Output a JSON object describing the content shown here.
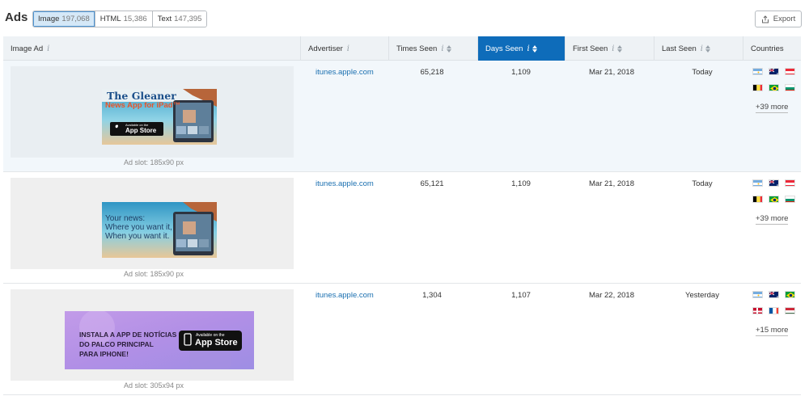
{
  "page": {
    "title": "Ads"
  },
  "filters": [
    {
      "label": "Image",
      "count": "197,068",
      "active": true
    },
    {
      "label": "HTML",
      "count": "15,386",
      "active": false
    },
    {
      "label": "Text",
      "count": "147,395",
      "active": false
    }
  ],
  "export_label": "Export",
  "columns": {
    "image_ad": "Image Ad",
    "advertiser": "Advertiser",
    "times_seen": "Times Seen",
    "days_seen": "Days Seen",
    "first_seen": "First Seen",
    "last_seen": "Last Seen",
    "countries": "Countries"
  },
  "rows": [
    {
      "advertiser": "itunes.apple.com",
      "times_seen": "65,218",
      "days_seen": "1,109",
      "first_seen": "Mar 21, 2018",
      "last_seen": "Today",
      "flags": [
        "argentina",
        "australia",
        "austria",
        "belgium",
        "brazil",
        "bulgaria"
      ],
      "more": "+39 more",
      "slot": "Ad slot: 185x90 px",
      "banner": {
        "line1": "The Gleaner",
        "line2": "News App for iPad™",
        "badge_small": "Available on the",
        "badge_big": "App Store"
      }
    },
    {
      "advertiser": "itunes.apple.com",
      "times_seen": "65,121",
      "days_seen": "1,109",
      "first_seen": "Mar 21, 2018",
      "last_seen": "Today",
      "flags": [
        "argentina",
        "australia",
        "austria",
        "belgium",
        "brazil",
        "bulgaria"
      ],
      "more": "+39 more",
      "slot": "Ad slot: 185x90 px",
      "banner": {
        "line1": "Your news:",
        "line2": "Where you want it,",
        "line3": "When you want it."
      }
    },
    {
      "advertiser": "itunes.apple.com",
      "times_seen": "1,304",
      "days_seen": "1,107",
      "first_seen": "Mar 22, 2018",
      "last_seen": "Yesterday",
      "flags": [
        "argentina",
        "australia",
        "brazil",
        "denmark",
        "france",
        "hungary"
      ],
      "more": "+15 more",
      "slot": "Ad slot: 305x94 px",
      "banner": {
        "line1": "INSTALA A APP DE NOTÍCIAS",
        "line2": "DO PALCO PRINCIPAL",
        "line3": "PARA IPHONE!",
        "badge_small": "Available on the",
        "badge_big": "App Store"
      }
    }
  ],
  "colors": {
    "accent": "#0e6cba",
    "link": "#1a6fb0",
    "header_bg": "#eef2f5"
  }
}
